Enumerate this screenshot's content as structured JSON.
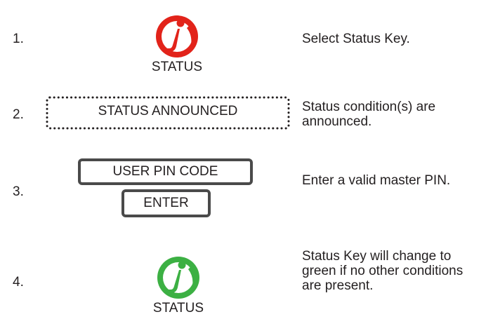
{
  "colors": {
    "status_red": "#e2231a",
    "status_green": "#3cb043",
    "box_border": "#4a4a4a",
    "dotted_border": "#231f20",
    "text": "#231f20"
  },
  "steps": [
    {
      "number": "1.",
      "icon": "info-status-icon-red",
      "icon_label": "STATUS",
      "description": "Select Status Key."
    },
    {
      "number": "2.",
      "display_text": "STATUS ANNOUNCED",
      "description": "Status condition(s) are announced."
    },
    {
      "number": "3.",
      "input_text": "USER PIN CODE",
      "button_label": "ENTER",
      "description": "Enter a valid master PIN."
    },
    {
      "number": "4.",
      "icon": "info-status-icon-green",
      "icon_label": "STATUS",
      "description": "Status Key will change to green if no other conditions are present."
    }
  ]
}
